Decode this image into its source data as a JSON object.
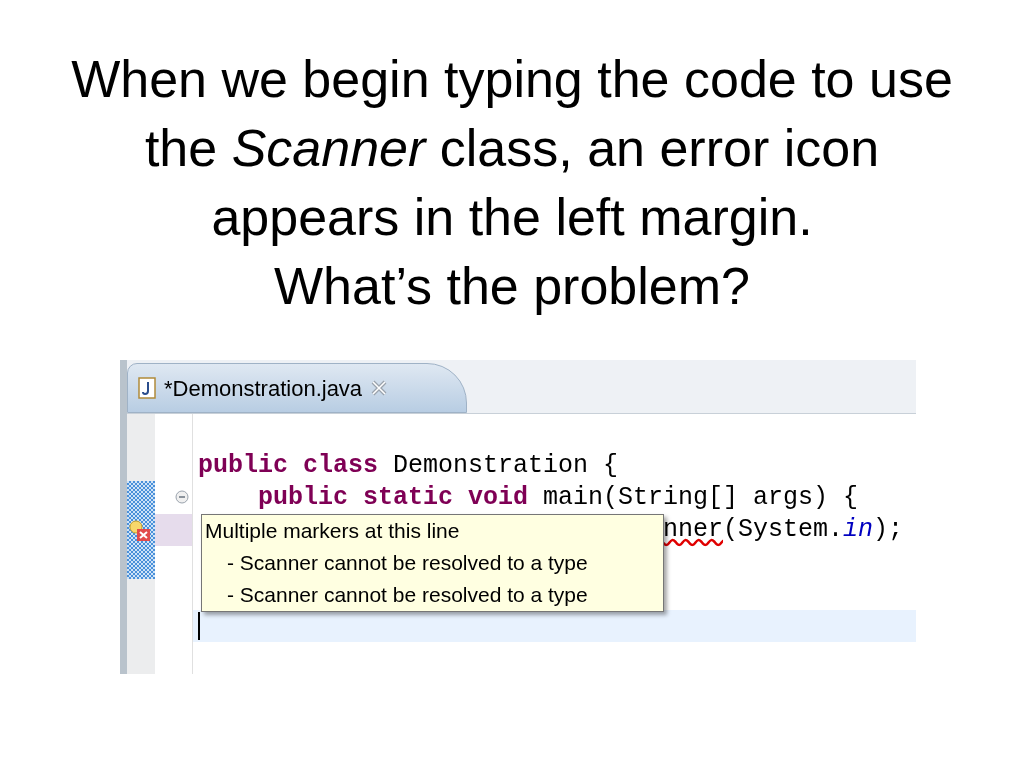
{
  "slide": {
    "title_lines": [
      "When we begin typing the code to use",
      "the *Scanner* class, an error icon",
      "appears in the left margin.",
      "What’s the problem?"
    ]
  },
  "editor": {
    "tab": {
      "label": "*Demonstration.java",
      "selected": true
    },
    "lines": [
      {
        "foldable": false,
        "error": false,
        "starts_under_tooltip": false,
        "current": false
      },
      {
        "tokens": [
          {
            "kind": "keyword",
            "text": "public class "
          },
          {
            "kind": "plain",
            "text": "Demonstration {"
          }
        ],
        "foldable": false,
        "error": false,
        "starts_under_tooltip": false,
        "current": false
      },
      {
        "tokens": [
          {
            "kind": "keyword",
            "text": "    public static void "
          },
          {
            "kind": "plain",
            "text": "main(String[] args) {"
          }
        ],
        "foldable": true,
        "error": false,
        "starts_under_tooltip": false,
        "current": false
      },
      {
        "tokens": [
          {
            "kind": "error",
            "text": "nner"
          },
          {
            "kind": "plain",
            "text": "(System."
          },
          {
            "kind": "field",
            "text": "in"
          },
          {
            "kind": "plain",
            "text": ");"
          }
        ],
        "foldable": false,
        "error": true,
        "starts_under_tooltip": true,
        "current": false
      },
      {
        "foldable": false,
        "error": false,
        "starts_under_tooltip": false,
        "current": false
      },
      {
        "foldable": false,
        "error": false,
        "starts_under_tooltip": false,
        "current": false
      },
      {
        "foldable": false,
        "error": false,
        "starts_under_tooltip": false,
        "current": true
      }
    ],
    "tooltip": {
      "title": "Multiple markers at this line",
      "items": [
        "- Scanner cannot be resolved to a type",
        "- Scanner cannot be resolved to a type"
      ]
    }
  }
}
